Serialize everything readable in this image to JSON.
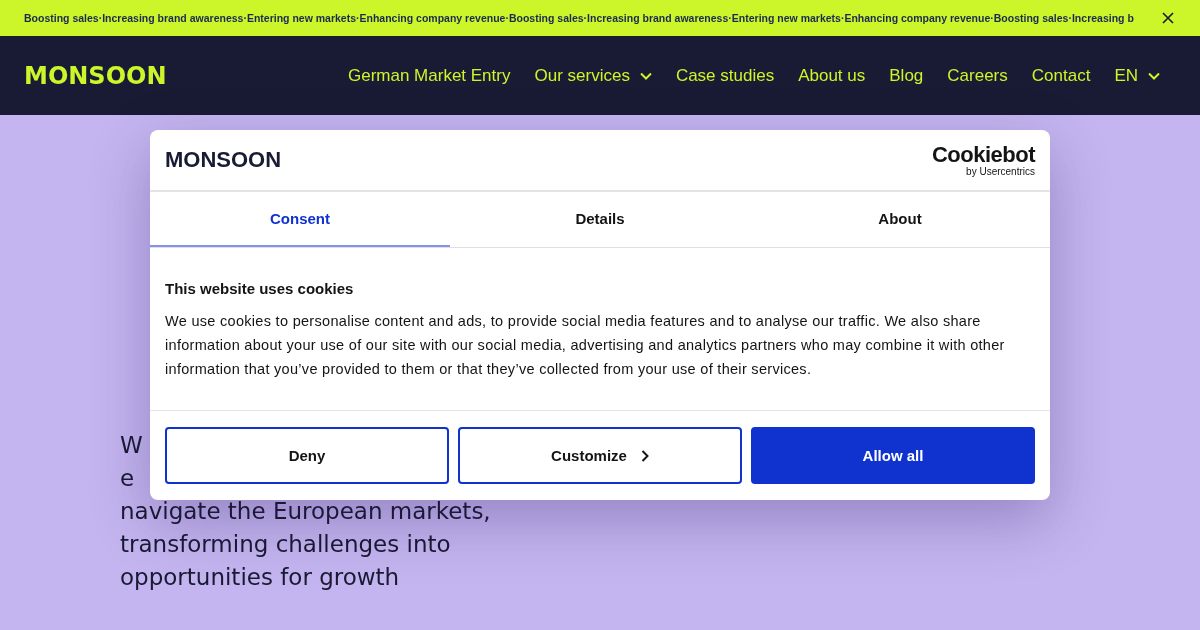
{
  "ticker": {
    "text": "Boosting sales·Increasing brand awareness·Entering new markets·Enhancing company revenue·Boosting sales·Increasing brand awareness·Entering new markets·Enhancing company revenue·Boosting sales·Increasing b"
  },
  "nav": {
    "logo": "MONSOON",
    "items": [
      {
        "label": "German Market Entry",
        "dropdown": false
      },
      {
        "label": "Our services",
        "dropdown": true
      },
      {
        "label": "Case studies",
        "dropdown": false
      },
      {
        "label": "About us",
        "dropdown": false
      },
      {
        "label": "Blog",
        "dropdown": false
      },
      {
        "label": "Careers",
        "dropdown": false
      },
      {
        "label": "Contact",
        "dropdown": false
      },
      {
        "label": "EN",
        "dropdown": true
      }
    ]
  },
  "hero": {
    "text_lines": [
      "W",
      "e",
      "navigate the European markets,",
      "transforming challenges into",
      "opportunities for growth"
    ]
  },
  "dialog": {
    "logo": "MONSOON",
    "brand": "Cookiebot",
    "brand_sub": "by Usercentrics",
    "tabs": [
      {
        "label": "Consent",
        "selected": true
      },
      {
        "label": "Details",
        "selected": false
      },
      {
        "label": "About",
        "selected": false
      }
    ],
    "title": "This website uses cookies",
    "body": "We use cookies to personalise content and ads, to provide social media features and to analyse our traffic. We also share information about your use of our site with our social media, advertising and analytics partners who may combine it with other information that you’ve provided to them or that they’ve collected from your use of their services.",
    "buttons": [
      {
        "label": "Deny",
        "kind": "outline"
      },
      {
        "label": "Customize",
        "kind": "chevron"
      },
      {
        "label": "Allow all",
        "kind": "primary"
      }
    ]
  }
}
